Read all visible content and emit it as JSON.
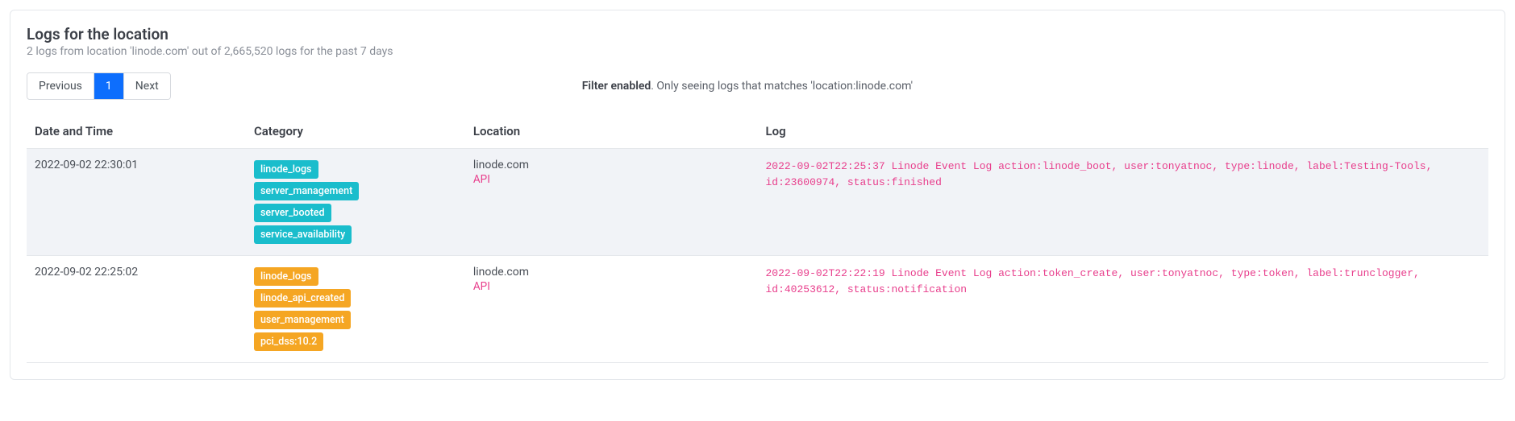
{
  "header": {
    "title": "Logs for the location",
    "subtitle": "2 logs from location 'linode.com' out of 2,665,520 logs for the past 7 days"
  },
  "pagination": {
    "prev": "Previous",
    "page": "1",
    "next": "Next"
  },
  "filter": {
    "label": "Filter enabled",
    "text": ". Only seeing logs that matches 'location:linode.com'"
  },
  "table": {
    "headers": {
      "date": "Date and Time",
      "category": "Category",
      "location": "Location",
      "log": "Log"
    },
    "rows": [
      {
        "date": "2022-09-02 22:30:01",
        "cat_color": "teal",
        "categories": [
          "linode_logs",
          "server_management",
          "server_booted",
          "service_availability"
        ],
        "location": "linode.com",
        "location_sub": "API",
        "log": "2022-09-02T22:25:37 Linode Event Log action:linode_boot, user:tonyatnoc, type:linode, label:Testing-Tools, id:23600974, status:finished"
      },
      {
        "date": "2022-09-02 22:25:02",
        "cat_color": "orange",
        "categories": [
          "linode_logs",
          "linode_api_created",
          "user_management",
          "pci_dss:10.2"
        ],
        "location": "linode.com",
        "location_sub": "API",
        "log": "2022-09-02T22:22:19 Linode Event Log action:token_create, user:tonyatnoc, type:token, label:trunclogger, id:40253612, status:notification"
      }
    ]
  }
}
